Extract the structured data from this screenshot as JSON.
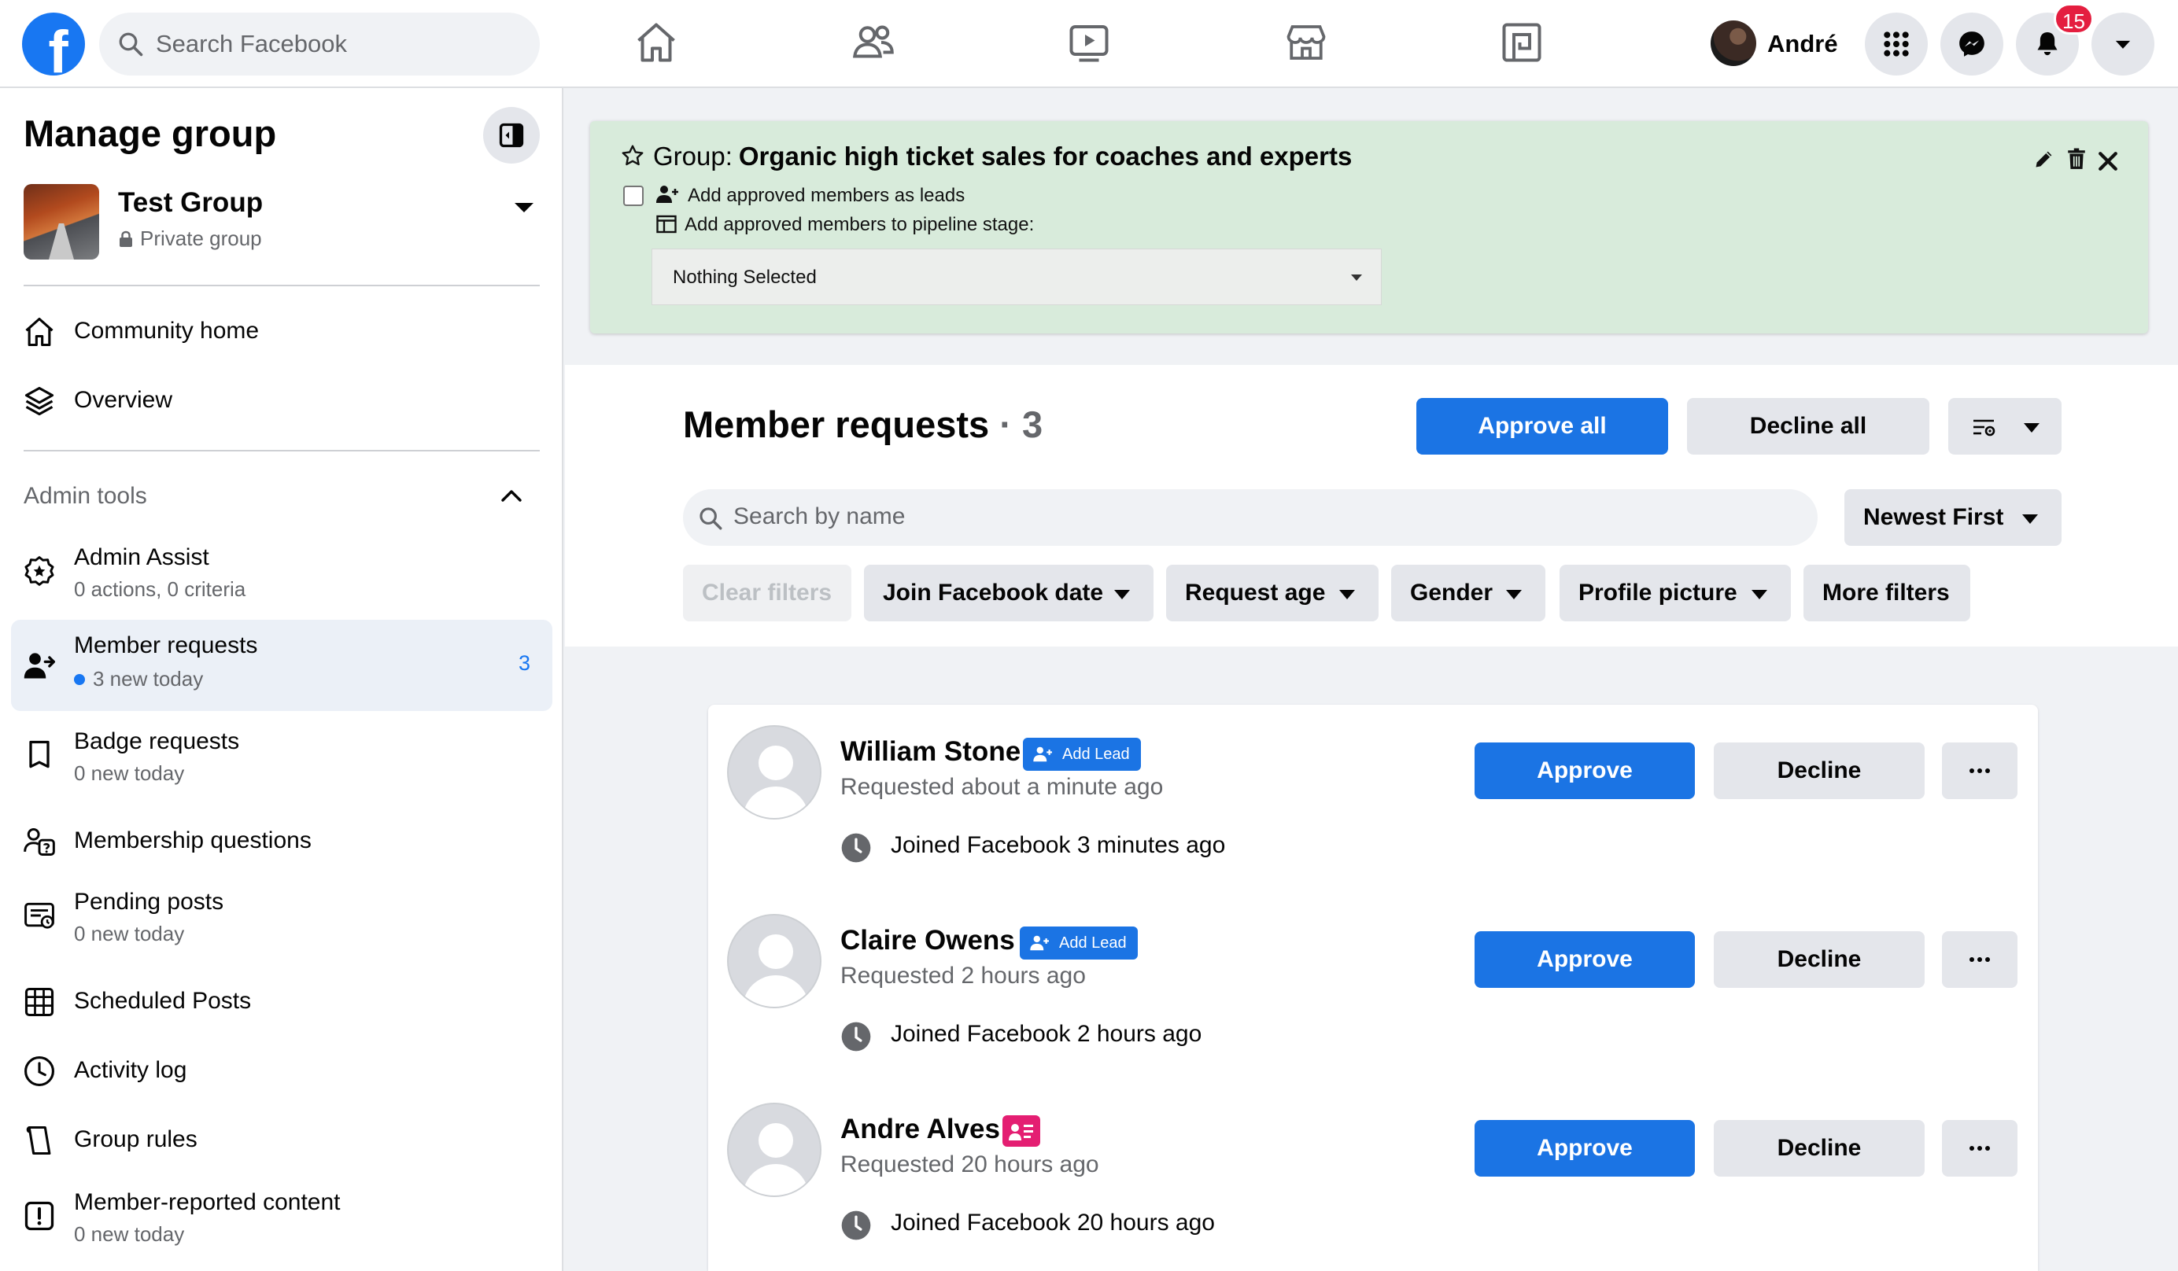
{
  "topbar": {
    "logo_letter": "f",
    "search_placeholder": "Search Facebook",
    "user_name": "André",
    "notification_count": "15",
    "nav_icons": [
      "home-icon",
      "friends-icon",
      "watch-icon",
      "marketplace-icon",
      "gaming-icon"
    ]
  },
  "sidebar": {
    "title": "Manage group",
    "group": {
      "name": "Test Group",
      "privacy": "Private group"
    },
    "items_top": [
      {
        "label": "Community home",
        "icon": "home-icon"
      },
      {
        "label": "Overview",
        "icon": "layers-icon"
      }
    ],
    "admin_tools_label": "Admin tools",
    "admin_items": [
      {
        "label": "Admin Assist",
        "sub": "0 actions, 0 criteria",
        "icon": "admin-assist-icon"
      },
      {
        "label": "Member requests",
        "sub": "3 new today",
        "count": "3",
        "icon": "member-requests-icon",
        "active": true
      },
      {
        "label": "Badge requests",
        "sub": "0 new today",
        "icon": "badge-icon"
      },
      {
        "label": "Membership questions",
        "icon": "membership-questions-icon"
      },
      {
        "label": "Pending posts",
        "sub": "0 new today",
        "icon": "pending-posts-icon"
      },
      {
        "label": "Scheduled Posts",
        "icon": "calendar-icon"
      },
      {
        "label": "Activity log",
        "icon": "clock-icon"
      },
      {
        "label": "Group rules",
        "icon": "rules-icon"
      },
      {
        "label": "Member-reported content",
        "sub": "0 new today",
        "icon": "report-icon"
      }
    ]
  },
  "extension_panel": {
    "group_prefix": "Group:",
    "group_name": "Organic high ticket sales for coaches and experts",
    "checkbox_label": "Add approved members as leads",
    "pipeline_label": "Add approved members to pipeline stage:",
    "select_value": "Nothing Selected",
    "checkbox_checked": false,
    "panel_color": "#d8ebdb"
  },
  "requests_header": {
    "title": "Member requests",
    "separator": "·",
    "count": "3",
    "approve_all": "Approve all",
    "decline_all": "Decline all",
    "search_placeholder": "Search by name",
    "sort": "Newest First",
    "filters": [
      "Clear filters",
      "Join Facebook date",
      "Request age",
      "Gender",
      "Profile picture",
      "More filters"
    ]
  },
  "requests": [
    {
      "name": "William Stone",
      "tag": "Add Lead",
      "requested": "Requested about a minute ago",
      "joined": "Joined Facebook 3 minutes ago"
    },
    {
      "name": "Claire Owens",
      "tag": "Add Lead",
      "requested": "Requested 2 hours ago",
      "joined": "Joined Facebook 2 hours ago"
    },
    {
      "name": "Andre Alves",
      "tag": "",
      "requested": "Requested 20 hours ago",
      "joined": "Joined Facebook 20 hours ago"
    }
  ],
  "request_actions": {
    "approve": "Approve",
    "decline": "Decline"
  },
  "colors": {
    "accent": "#1b74e4",
    "fb_blue": "#1877f2",
    "badge_red": "#e41e3f",
    "pink_tag": "#e41e72"
  }
}
